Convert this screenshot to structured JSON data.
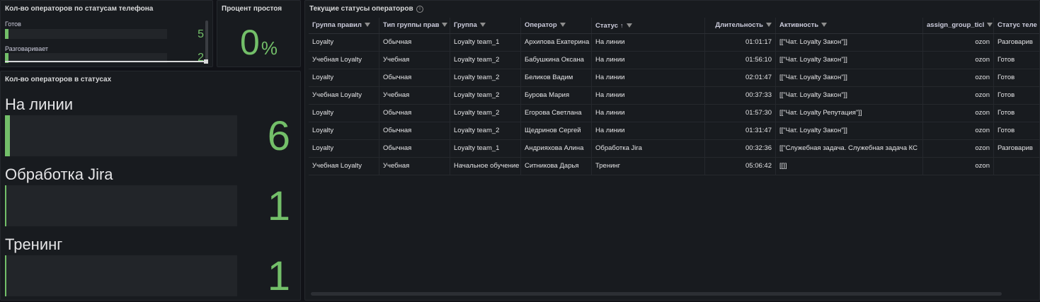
{
  "phone_panel": {
    "title": "Кол-во операторов по статусам телефона",
    "gauges": [
      {
        "label": "Готов",
        "value": "5",
        "fill_fraction": 0.02
      },
      {
        "label": "Разговаривает",
        "value": "2",
        "fill_fraction": 0.005
      }
    ]
  },
  "idle_panel": {
    "title": "Процент простоя",
    "value": "0",
    "unit": "%"
  },
  "status_panel": {
    "title": "Кол-во операторов в статусах",
    "items": [
      {
        "label": "На линии",
        "value": "6",
        "fill_fraction": 0.02
      },
      {
        "label": "Обработка Jira",
        "value": "1",
        "fill_fraction": 0.005
      },
      {
        "label": "Тренинг",
        "value": "1",
        "fill_fraction": 0.005
      }
    ]
  },
  "table_panel": {
    "title": "Текущие статусы операторов",
    "columns": [
      "Группа правил",
      "Тип группы прав",
      "Группа",
      "Оператор",
      "Статус",
      "Длительность",
      "Активность",
      "assign_group_ticl",
      "Статус теле"
    ],
    "sort_indicator": "↑",
    "rows": [
      [
        "Loyalty",
        "Обычная",
        "Loyalty team_1",
        "Архипова Екатерина",
        "На линии",
        "01:01:17",
        "[[\"Чат. Loyalty Закон\"]]",
        "ozon",
        "Разговарив"
      ],
      [
        "Учебная Loyalty",
        "Учебная",
        "Loyalty team_2",
        "Бабушкина Оксана",
        "На линии",
        "01:56:10",
        "[[\"Чат. Loyalty Закон\"]]",
        "ozon",
        "Готов"
      ],
      [
        "Loyalty",
        "Обычная",
        "Loyalty team_2",
        "Беликов Вадим",
        "На линии",
        "02:01:47",
        "[[\"Чат. Loyalty Закон\"]]",
        "ozon",
        "Готов"
      ],
      [
        "Учебная Loyalty",
        "Учебная",
        "Loyalty team_2",
        "Бурова Мария",
        "На линии",
        "00:37:33",
        "[[\"Чат. Loyalty Закон\"]]",
        "ozon",
        "Готов"
      ],
      [
        "Loyalty",
        "Обычная",
        "Loyalty team_2",
        "Егорова Светлана",
        "На линии",
        "01:57:30",
        "[[\"Чат. Loyalty Репутация\"]]",
        "ozon",
        "Готов"
      ],
      [
        "Loyalty",
        "Обычная",
        "Loyalty team_2",
        "Щедринов Сергей",
        "На линии",
        "01:31:47",
        "[[\"Чат. Loyalty Закон\"]]",
        "ozon",
        "Готов"
      ],
      [
        "Loyalty",
        "Обычная",
        "Loyalty team_1",
        "Андрияхова Алина",
        "Обработка Jira",
        "00:32:36",
        "[[\"Служебная задача. Служебная задача КС",
        "ozon",
        "Разговарив"
      ],
      [
        "Учебная Loyalty",
        "Учебная",
        "Начальное обучение",
        "Ситникова Дарья",
        "Тренинг",
        "05:06:42",
        "[[]]",
        "ozon",
        ""
      ]
    ]
  },
  "colors": {
    "accent_green": "#73bf69",
    "panel_bg": "#181b1f",
    "page_bg": "#111217"
  }
}
